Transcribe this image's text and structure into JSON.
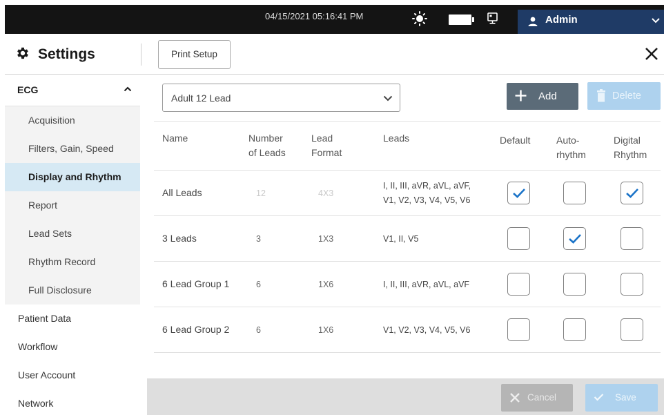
{
  "statusbar": {
    "datetime": "04/15/2021 05:16:41 PM",
    "icons": [
      "sun-icon",
      "battery-icon",
      "monitor-icon"
    ],
    "user": {
      "name": "Admin",
      "icon": "user-icon"
    }
  },
  "header": {
    "title": "Settings",
    "print_setup_label": "Print Setup",
    "close_icon": "close-icon"
  },
  "sidebar": {
    "group": {
      "label": "ECG",
      "expanded": true
    },
    "sub_items": [
      {
        "label": "Acquisition",
        "active": false
      },
      {
        "label": "Filters, Gain, Speed",
        "active": false
      },
      {
        "label": "Display and Rhythm",
        "active": true
      },
      {
        "label": "Report",
        "active": false
      },
      {
        "label": "Lead Sets",
        "active": false
      },
      {
        "label": "Rhythm Record",
        "active": false
      },
      {
        "label": "Full Disclosure",
        "active": false
      }
    ],
    "top_items": [
      {
        "label": "Patient Data"
      },
      {
        "label": "Workflow"
      },
      {
        "label": "User Account"
      },
      {
        "label": "Network"
      }
    ]
  },
  "main": {
    "dropdown": {
      "selected": "Adult 12 Lead"
    },
    "add_label": "Add",
    "delete_label": "Delete",
    "delete_enabled": false,
    "columns": {
      "name": "Name",
      "num_leads_1": "Number",
      "num_leads_2": "of Leads",
      "format_1": "Lead",
      "format_2": "Format",
      "leads": "Leads",
      "default": "Default",
      "auto_1": "Auto-",
      "auto_2": "rhythm",
      "digital_1": "Digital",
      "digital_2": "Rhythm"
    },
    "rows": [
      {
        "name": "All Leads",
        "count": "12",
        "format": "4X3",
        "leads_1": "I, II, III, aVR, aVL, aVF,",
        "leads_2": "V1, V2, V3, V4, V5, V6",
        "default": true,
        "auto_rhythm": false,
        "digital_rhythm": true,
        "disabled": true
      },
      {
        "name": "3 Leads",
        "count": "3",
        "format": "1X3",
        "leads_1": "V1, II, V5",
        "leads_2": "",
        "default": false,
        "auto_rhythm": true,
        "digital_rhythm": false,
        "disabled": false
      },
      {
        "name": "6 Lead Group 1",
        "count": "6",
        "format": "1X6",
        "leads_1": "I, II, III, aVR, aVL, aVF",
        "leads_2": "",
        "default": false,
        "auto_rhythm": false,
        "digital_rhythm": false,
        "disabled": false
      },
      {
        "name": "6 Lead Group 2",
        "count": "6",
        "format": "1X6",
        "leads_1": "V1, V2, V3, V4, V5, V6",
        "leads_2": "",
        "default": false,
        "auto_rhythm": false,
        "digital_rhythm": false,
        "disabled": false
      }
    ],
    "footer": {
      "cancel_label": "Cancel",
      "save_label": "Save",
      "enabled": false
    }
  },
  "colors": {
    "accent_blue": "#1a73c8",
    "user_bg": "#1f3b66",
    "active_nav": "#d6e9f4",
    "disabled_button": "#aed2ee"
  }
}
